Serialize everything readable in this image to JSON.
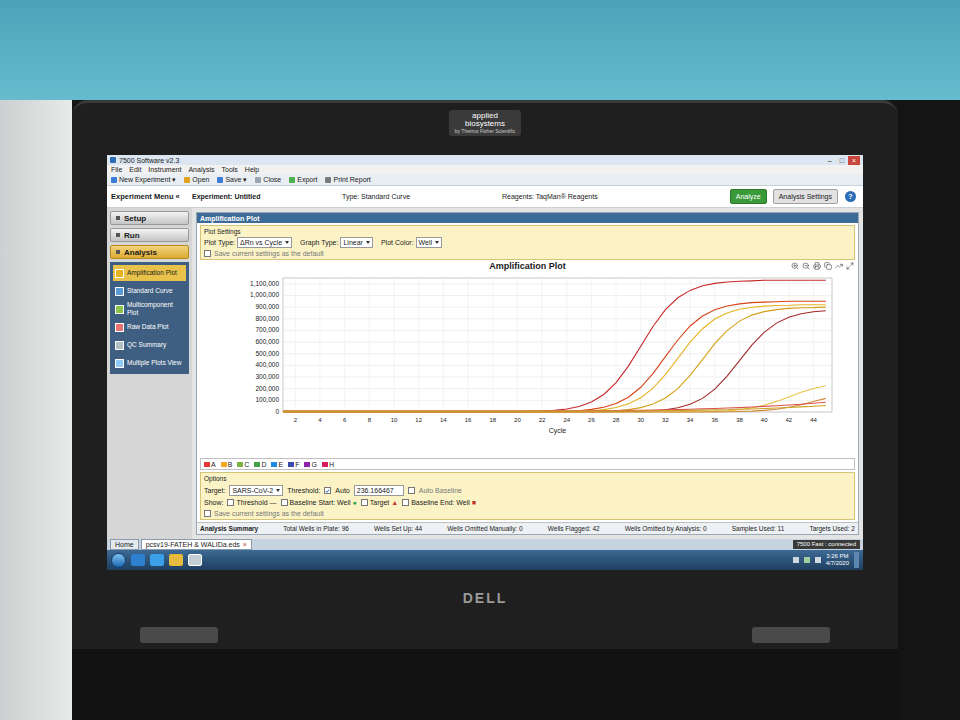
{
  "bezel": {
    "brand": "applied biosystems",
    "sub": "by Thermo Fisher Scientific",
    "maker": "DELL"
  },
  "window": {
    "title": "7500 Software v2.3",
    "controls": [
      "–",
      "□",
      "×"
    ]
  },
  "menu": [
    "File",
    "Edit",
    "Instrument",
    "Analysis",
    "Tools",
    "Help"
  ],
  "toolbar": [
    "New Experiment ▾",
    "Open",
    "Save ▾",
    "Close",
    "Export",
    "Print Report"
  ],
  "experiment_bar": {
    "menu_label": "Experiment Menu «",
    "experiment": "Experiment: Untitled",
    "type": "Type: Standard Curve",
    "reagents": "Reagents: TaqMan® Reagents",
    "analyze": "Analyze",
    "settings": "Analysis Settings",
    "help": "?"
  },
  "nav": [
    {
      "label": "Setup",
      "selected": false
    },
    {
      "label": "Run",
      "selected": false
    },
    {
      "label": "Analysis",
      "selected": true
    }
  ],
  "analysis_items": [
    {
      "label": "Amplification Plot",
      "selected": true
    },
    {
      "label": "Standard Curve",
      "selected": false
    },
    {
      "label": "Multicomponent Plot",
      "selected": false
    },
    {
      "label": "Raw Data Plot",
      "selected": false
    },
    {
      "label": "QC Summary",
      "selected": false
    },
    {
      "label": "Multiple Plots View",
      "selected": false
    }
  ],
  "panel": {
    "title": "Amplification Plot",
    "plot_settings": "Plot Settings",
    "fields": [
      {
        "label": "Plot Type:",
        "value": "ΔRn vs Cycle"
      },
      {
        "label": "Graph Type:",
        "value": "Linear"
      },
      {
        "label": "Plot Color:",
        "value": "Well"
      }
    ],
    "save_default": {
      "label": "Save current settings as the default",
      "checked": false
    }
  },
  "chart": {
    "title": "Amplification Plot",
    "x_label": "Cycle",
    "y_max": 1150000,
    "y_ticks": [
      "0",
      "100,000",
      "200,000",
      "300,000",
      "400,000",
      "500,000",
      "600,000",
      "700,000",
      "800,000",
      "900,000",
      "1,000,000",
      "1,100,000"
    ],
    "x_ticks": [
      "2",
      "4",
      "6",
      "8",
      "10",
      "12",
      "14",
      "16",
      "18",
      "20",
      "22",
      "24",
      "26",
      "28",
      "30",
      "32",
      "34",
      "36",
      "38",
      "40",
      "42",
      "44"
    ],
    "series": [
      {
        "color": "#c62828",
        "values": [
          0,
          0,
          0,
          0,
          0,
          0,
          0,
          0,
          0,
          0,
          0,
          0,
          0,
          0,
          0,
          0,
          0,
          0,
          0,
          2000,
          5000,
          8000,
          14000,
          26000,
          47000,
          86000,
          150000,
          252000,
          394000,
          565000,
          736000,
          878000,
          980000,
          1044000,
          1083000,
          1104000,
          1116000,
          1122000,
          1125000,
          1130000,
          1130000,
          1130000,
          1130000,
          1130000,
          1130000
        ]
      },
      {
        "color": "#d84315",
        "values": [
          0,
          0,
          0,
          0,
          0,
          0,
          0,
          0,
          0,
          0,
          0,
          0,
          0,
          0,
          0,
          0,
          0,
          0,
          0,
          0,
          0,
          2000,
          4000,
          7000,
          11000,
          22000,
          40000,
          72000,
          126000,
          212000,
          332000,
          475000,
          618000,
          738000,
          824000,
          878000,
          910000,
          928000,
          939000,
          943000,
          946000,
          950000,
          950000,
          950000,
          950000
        ]
      },
      {
        "color": "#e6b422",
        "values": [
          0,
          0,
          0,
          0,
          0,
          0,
          0,
          0,
          0,
          0,
          0,
          0,
          0,
          0,
          0,
          0,
          0,
          0,
          0,
          0,
          0,
          0,
          2000,
          4000,
          6000,
          11000,
          21000,
          39000,
          70000,
          122000,
          205000,
          321000,
          460000,
          599000,
          715000,
          798000,
          850000,
          881000,
          899000,
          909000,
          914000,
          916000,
          920000,
          920000,
          920000
        ]
      },
      {
        "color": "#d4a017",
        "values": [
          0,
          0,
          0,
          0,
          0,
          0,
          0,
          0,
          0,
          0,
          0,
          0,
          0,
          0,
          0,
          0,
          0,
          0,
          0,
          0,
          0,
          0,
          0,
          0,
          2000,
          4000,
          6000,
          11000,
          21000,
          38000,
          68000,
          120000,
          201000,
          314000,
          450000,
          586000,
          699000,
          780000,
          832000,
          862000,
          879000,
          889000,
          894000,
          896000,
          900000
        ]
      },
      {
        "color": "#a52a2a",
        "values": [
          0,
          0,
          0,
          0,
          0,
          0,
          0,
          0,
          0,
          0,
          0,
          0,
          0,
          0,
          0,
          0,
          0,
          0,
          0,
          0,
          0,
          0,
          0,
          0,
          0,
          0,
          0,
          2000,
          4000,
          6000,
          11000,
          20000,
          37000,
          67000,
          117000,
          196000,
          307000,
          440000,
          573000,
          684000,
          763000,
          813000,
          843000,
          860000,
          869000
        ]
      },
      {
        "color": "#e8c547",
        "values": [
          0,
          0,
          0,
          0,
          0,
          0,
          0,
          0,
          0,
          0,
          0,
          0,
          0,
          0,
          0,
          0,
          0,
          0,
          0,
          0,
          0,
          0,
          0,
          0,
          0,
          0,
          0,
          0,
          0,
          0,
          0,
          0,
          1000,
          2000,
          3000,
          6000,
          11000,
          20000,
          35000,
          58000,
          91000,
          130000,
          169000,
          202000,
          225000
        ]
      },
      {
        "color": "#cf8a3a",
        "values": [
          0,
          0,
          0,
          0,
          0,
          0,
          0,
          0,
          0,
          0,
          0,
          0,
          0,
          0,
          0,
          0,
          0,
          0,
          0,
          0,
          0,
          0,
          0,
          0,
          0,
          0,
          0,
          0,
          0,
          0,
          0,
          0,
          0,
          0,
          0,
          1000,
          2000,
          4000,
          8000,
          14000,
          24000,
          40000,
          63000,
          90000,
          117000
        ]
      },
      {
        "color": "#d9534f",
        "values": [
          10000,
          10000,
          10000,
          10000,
          10000,
          10000,
          10000,
          10000,
          10000,
          10000,
          10000,
          10000,
          10000,
          10000,
          10000,
          10000,
          10000,
          10000,
          10000,
          10000,
          10000,
          10000,
          10000,
          10000,
          10000,
          11000,
          12000,
          13000,
          14000,
          15000,
          17000,
          19000,
          21000,
          24000,
          27000,
          30000,
          34000,
          38000,
          43000,
          48000,
          54000,
          60000,
          67000,
          75000,
          83000
        ]
      },
      {
        "color": "#c9a227",
        "values": [
          8000,
          8000,
          8000,
          8000,
          8000,
          8000,
          8000,
          8000,
          8000,
          8000,
          8000,
          8000,
          8000,
          8000,
          8000,
          8000,
          8000,
          8000,
          8000,
          8000,
          8000,
          8000,
          8000,
          8000,
          8000,
          8000,
          8000,
          8000,
          9000,
          10000,
          11000,
          12000,
          13000,
          14000,
          16000,
          18000,
          20000,
          23000,
          26000,
          30000,
          34000,
          39000,
          44000,
          50000,
          56000
        ]
      }
    ]
  },
  "legend": [
    {
      "label": "A",
      "color": "#e53935"
    },
    {
      "label": "B",
      "color": "#f5a623"
    },
    {
      "label": "C",
      "color": "#7cb342"
    },
    {
      "label": "D",
      "color": "#43a047"
    },
    {
      "label": "E",
      "color": "#1e88e5"
    },
    {
      "label": "F",
      "color": "#3949ab"
    },
    {
      "label": "G",
      "color": "#8e24aa"
    },
    {
      "label": "H",
      "color": "#d81b60"
    }
  ],
  "options": {
    "title": "Options",
    "target_label": "Target:",
    "target": "SARS-CoV-2",
    "threshold_label": "Threshold:",
    "auto": {
      "label": "Auto",
      "checked": true
    },
    "threshold": "236.166467",
    "auto_baseline": {
      "label": "Auto Baseline",
      "checked": false
    },
    "show_label": "Show:",
    "show": [
      {
        "label": "Threshold",
        "checked": false,
        "marker": "—",
        "color": "#333333"
      },
      {
        "label": "Baseline Start: Well",
        "checked": false,
        "marker": "●",
        "color": "#2e9e4f"
      },
      {
        "label": "Target",
        "checked": false,
        "marker": "▲",
        "color": "#c0392b"
      },
      {
        "label": "Baseline End: Well",
        "checked": false,
        "marker": "■",
        "color": "#c0392b"
      }
    ],
    "save_default": {
      "label": "Save current settings as the default",
      "checked": false
    }
  },
  "summary": {
    "title": "Analysis Summary",
    "items": [
      "Total Wells in Plate: 96",
      "Wells Set Up: 44",
      "Wells Omitted Manually: 0",
      "Wells Flagged: 42",
      "Wells Omitted by Analysis: 0",
      "Samples Used: 11",
      "Targets Used: 2"
    ]
  },
  "doc_tabs": [
    {
      "label": "Home",
      "selected": false,
      "close": ""
    },
    {
      "label": "pcsv19-FATEH & WALIDa.eds",
      "selected": true,
      "close": "×"
    }
  ],
  "status": "7500 Fast : connected",
  "taskbar": {
    "time": "3:26 PM",
    "date": "4/7/2020"
  }
}
